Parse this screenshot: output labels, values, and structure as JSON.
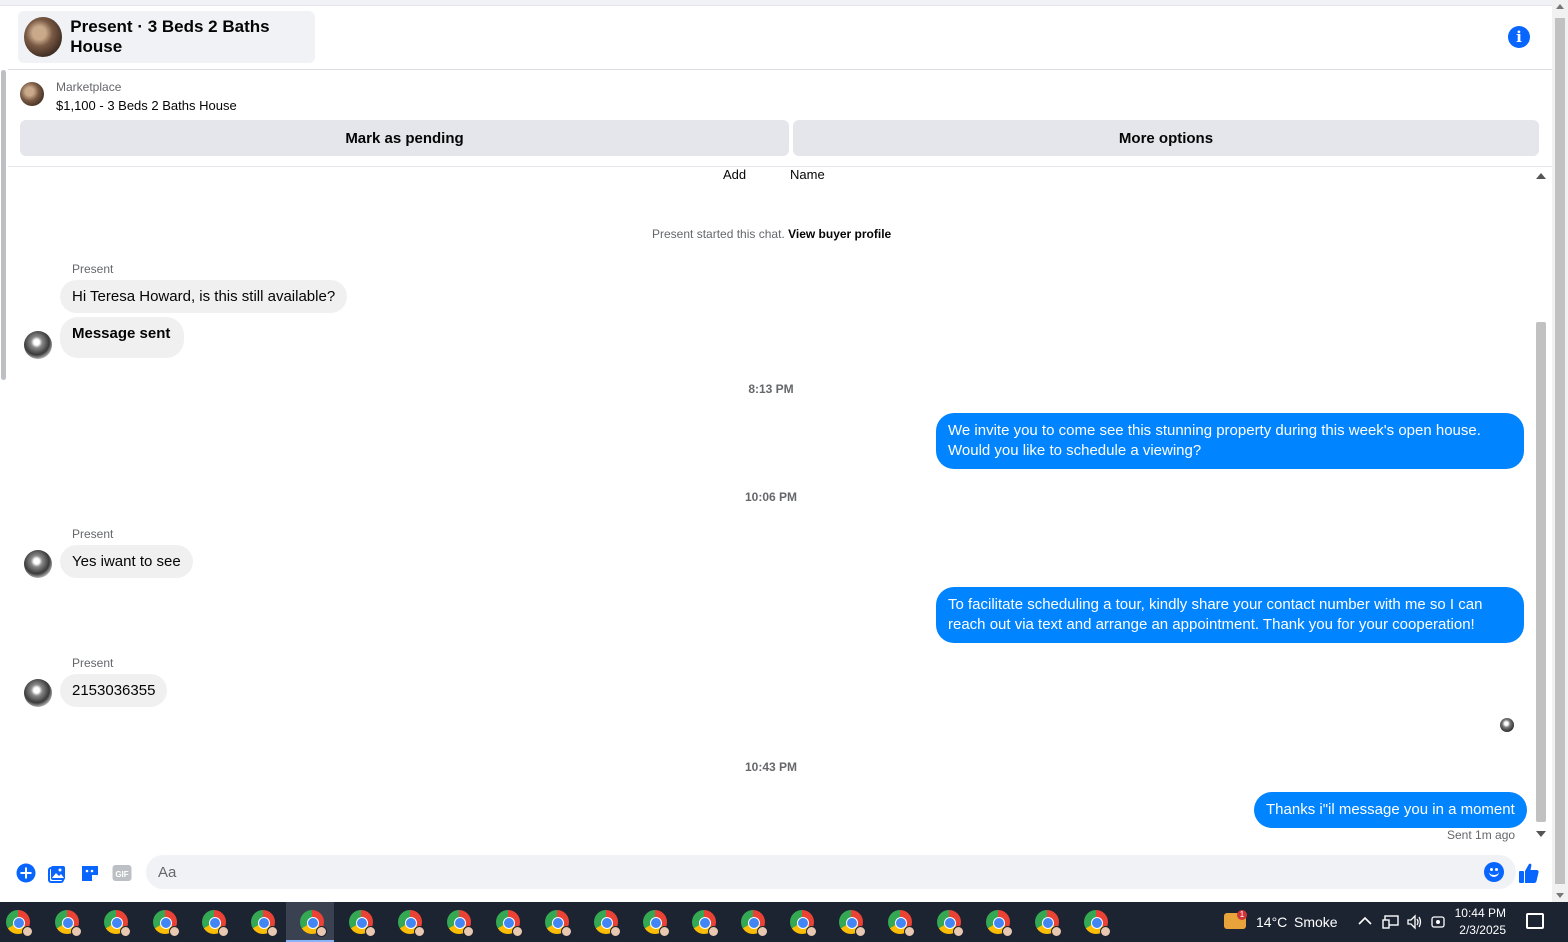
{
  "header": {
    "title": "Present · 3 Beds 2 Baths House",
    "info_icon": "info-icon"
  },
  "listing": {
    "category": "Marketplace",
    "price_title": "$1,100 - 3 Beds 2 Baths House",
    "mark_pending": "Mark as pending",
    "more_options": "More options"
  },
  "chat": {
    "top_labels": [
      "Add",
      "Name"
    ],
    "system_prefix": "Present started this chat.",
    "system_link": "View buyer profile",
    "messages": [
      {
        "sender": "Present",
        "text": "Hi Teresa Howard, is this still available?"
      },
      {
        "text": "Message sent"
      },
      {
        "time": "8:13 PM"
      },
      {
        "text": "We invite you to come see this stunning property during this week's open house. Would you like to schedule a viewing?"
      },
      {
        "time": "10:06 PM"
      },
      {
        "sender": "Present",
        "text": "Yes  iwant to see"
      },
      {
        "text": "To facilitate scheduling a tour, kindly share your contact number with me so I can reach out via text and arrange an appointment. Thank you for your cooperation!"
      },
      {
        "sender": "Present",
        "text": "2153036355"
      },
      {
        "time": "10:43 PM"
      },
      {
        "text": "Thanks i\"il message you in a moment"
      }
    ],
    "status": "Sent 1m ago"
  },
  "composer": {
    "placeholder": "Aa",
    "icons": [
      "plus-icon",
      "photo-icon",
      "sticker-icon",
      "gif-icon",
      "emoji-icon",
      "like-icon"
    ],
    "gif_label": "GIF"
  },
  "taskbar": {
    "weather_temp": "14°C",
    "weather_desc": "Smoke",
    "weather_badge": "1",
    "time": "10:44 PM",
    "date": "2/3/2025"
  },
  "colors": {
    "accent": "#0866ff",
    "outgoing_bubble": "#0084ff",
    "incoming_bubble": "#f0f0f0",
    "taskbar": "#1c2331"
  }
}
